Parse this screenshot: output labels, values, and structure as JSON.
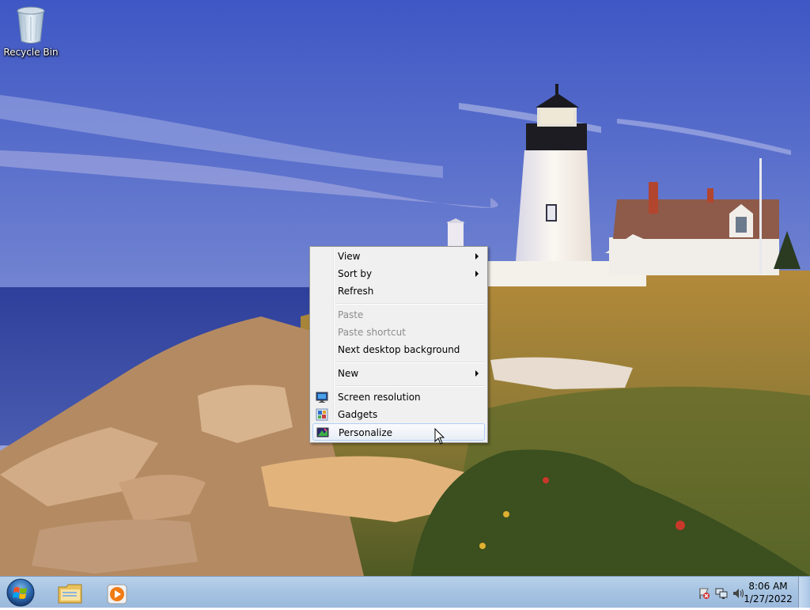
{
  "desktop": {
    "icons": [
      {
        "label": "Recycle Bin",
        "icon": "recycle-bin-icon"
      }
    ]
  },
  "context_menu": {
    "items": [
      {
        "label": "View",
        "submenu": true,
        "enabled": true
      },
      {
        "label": "Sort by",
        "submenu": true,
        "enabled": true
      },
      {
        "label": "Refresh",
        "enabled": true
      },
      {
        "label": "Paste",
        "enabled": false
      },
      {
        "label": "Paste shortcut",
        "enabled": false
      },
      {
        "label": "Next desktop background",
        "enabled": true
      },
      {
        "label": "New",
        "submenu": true,
        "enabled": true
      },
      {
        "label": "Screen resolution",
        "icon": "screen-resolution-icon",
        "enabled": true
      },
      {
        "label": "Gadgets",
        "icon": "gadgets-icon",
        "enabled": true
      },
      {
        "label": "Personalize",
        "icon": "personalize-icon",
        "enabled": true,
        "highlighted": true
      }
    ]
  },
  "taskbar": {
    "pinned": [
      {
        "name": "Windows Explorer",
        "icon": "folder-icon"
      },
      {
        "name": "Windows Media Player",
        "icon": "media-player-icon"
      }
    ],
    "tray": {
      "icons": [
        "action-center-icon",
        "network-icon",
        "volume-icon"
      ],
      "time": "8:06 AM",
      "date": "1/27/2022"
    }
  },
  "colors": {
    "menu_bg": "#f0f0f0",
    "menu_border": "#979797",
    "menu_highlight_border": "#aecff7",
    "taskbar": "#a7c4e3",
    "disabled_text": "#8d8d8d"
  }
}
